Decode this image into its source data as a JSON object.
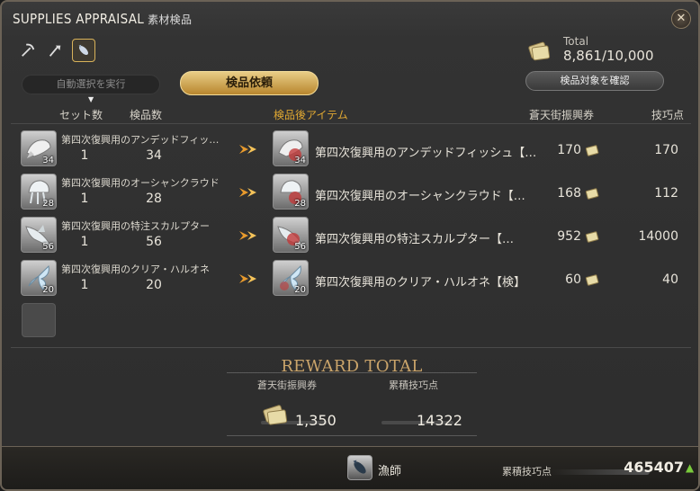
{
  "window": {
    "title": "SUPPLIES APPRAISAL",
    "subtitle": "素材検品",
    "close_icon": "close-icon"
  },
  "job_tabs": [
    {
      "icon": "pickaxe-icon",
      "active": false
    },
    {
      "icon": "hatchet-icon",
      "active": false
    },
    {
      "icon": "fishing-icon",
      "active": true
    }
  ],
  "total": {
    "label": "Total",
    "value": "8,861/10,000"
  },
  "buttons": {
    "auto_select": "自動選択を実行",
    "request_appraisal": "検品依頼",
    "confirm_targets": "検品対象を確認"
  },
  "columns": {
    "set_count": "セット数",
    "appraise_count": "検品数",
    "post_item": "検品後アイテム",
    "scrip": "蒼天街振興券",
    "craft_points": "技巧点"
  },
  "rows": [
    {
      "name_left": "第四次復興用のアンデッドフィッ…",
      "qty": "34",
      "sets": "1",
      "count": "34",
      "name_right": "第四次復興用のアンデッドフィッシュ【…",
      "scrip": "170",
      "craft": "170"
    },
    {
      "name_left": "第四次復興用のオーシャンクラウド",
      "qty": "28",
      "sets": "1",
      "count": "28",
      "name_right": "第四次復興用のオーシャンクラウド【…",
      "scrip": "168",
      "craft": "112"
    },
    {
      "name_left": "第四次復興用の特注スカルプター",
      "qty": "56",
      "sets": "1",
      "count": "56",
      "name_right": "第四次復興用の特注スカルプター【…",
      "scrip": "952",
      "craft": "14000"
    },
    {
      "name_left": "第四次復興用のクリア・ハルオネ",
      "qty": "20",
      "sets": "1",
      "count": "20",
      "name_right": "第四次復興用のクリア・ハルオネ【検】",
      "scrip": "60",
      "craft": "40"
    }
  ],
  "reward": {
    "title": "REWARD TOTAL",
    "scrip_label": "蒼天街振興券",
    "craft_label": "累積技巧点",
    "scrip_value": "1,350",
    "craft_value": "14322"
  },
  "footer": {
    "job_name": "漁師",
    "cumulative_label": "累積技巧点",
    "cumulative_value": "465407"
  },
  "colors": {
    "accent_gold": "#e0a832",
    "button_gold": "#d4ab55",
    "up_green": "#7acb3c"
  }
}
